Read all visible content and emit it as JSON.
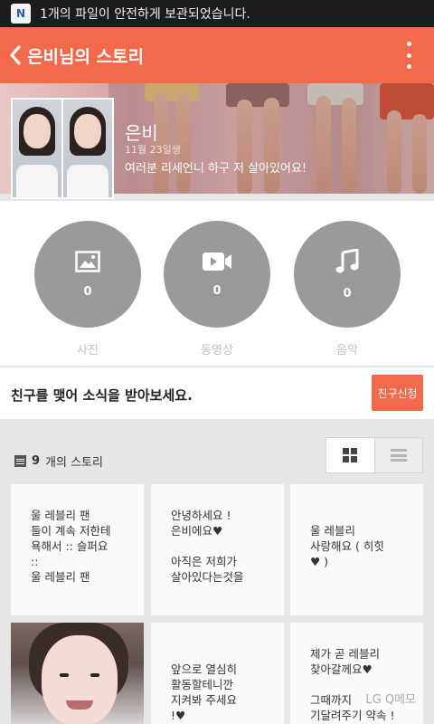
{
  "status_bar": {
    "app_badge": "N",
    "notification": "1개의 파일이 안전하게 보관되었습니다."
  },
  "header": {
    "title": "은비님의 스토리"
  },
  "profile": {
    "name": "은비",
    "birthday": "11월 23일생",
    "status_message": "여러분 리세언니 하구 저 살아있어요!"
  },
  "media": [
    {
      "icon": "photo-icon",
      "count": "0",
      "label": "사진"
    },
    {
      "icon": "video-icon",
      "count": "0",
      "label": "동영상"
    },
    {
      "icon": "music-note-icon",
      "count": "0",
      "label": "음악"
    }
  ],
  "friend": {
    "prompt": "친구를 맺어 소식을 받아보세요.",
    "button": "친구신청"
  },
  "stories": {
    "count": "9",
    "count_suffix": "개의 스토리",
    "view_modes": [
      "grid-view-icon",
      "list-view-icon"
    ],
    "cards": [
      {
        "text": "울 레블리 팬\n들이 계속 저한테\n욕해서 :: 슬퍼요\n::\n울 레블리 팬"
      },
      {
        "text": "안녕하세요 !\n은비에요♥\n\n아직은 저희가\n살아있다는것을"
      },
      {
        "text": "\n울 레블리\n사랑해요 ( 히힛\n♥ )"
      },
      {
        "text": ""
      },
      {
        "text": "\n앞으로 열심히\n활동할테니깐\n지켜봐 주세요\n!♥"
      },
      {
        "text": "제가 곧 레블리\n찾아갈께요♥\n\n그때까지\n기달려주기 약속 !"
      }
    ]
  },
  "watermark": "LG Q메모"
}
